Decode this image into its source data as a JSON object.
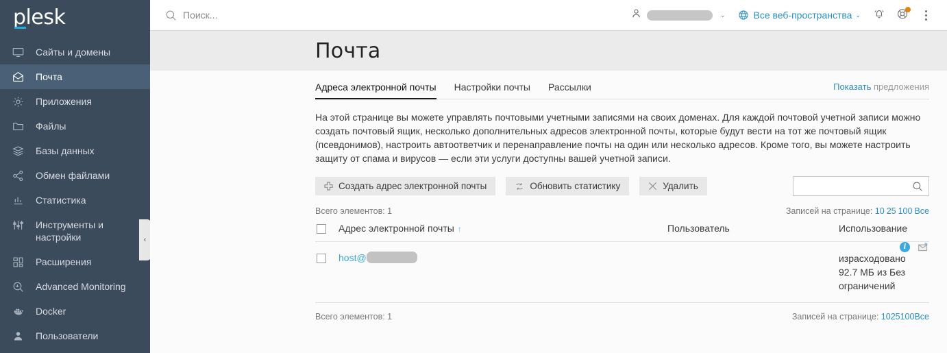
{
  "sidebar": {
    "logo": "plesk",
    "items": [
      {
        "label": "Сайты и домены",
        "icon": "monitor-icon",
        "active": false
      },
      {
        "label": "Почта",
        "icon": "mail-icon",
        "active": true
      },
      {
        "label": "Приложения",
        "icon": "gear-icon",
        "active": false
      },
      {
        "label": "Файлы",
        "icon": "folder-icon",
        "active": false
      },
      {
        "label": "Базы данных",
        "icon": "database-icon",
        "active": false
      },
      {
        "label": "Обмен файлами",
        "icon": "share-icon",
        "active": false
      },
      {
        "label": "Статистика",
        "icon": "chart-icon",
        "active": false
      },
      {
        "label": "Инструменты и настройки",
        "icon": "sliders-icon",
        "active": false
      },
      {
        "label": "Расширения",
        "icon": "extensions-icon",
        "active": false
      },
      {
        "label": "Advanced Monitoring",
        "icon": "magnifier-chart-icon",
        "active": false
      },
      {
        "label": "Docker",
        "icon": "docker-icon",
        "active": false
      },
      {
        "label": "Пользователи",
        "icon": "user-icon",
        "active": false
      }
    ],
    "collapse_label": "‹"
  },
  "topbar": {
    "search_placeholder": "Поиск...",
    "user_name": "",
    "workspace_label": "Все веб-пространства",
    "caret": "⌄"
  },
  "page": {
    "title": "Почта"
  },
  "tabs": [
    {
      "label": "Адреса электронной почты",
      "active": true
    },
    {
      "label": "Настройки почты",
      "active": false
    },
    {
      "label": "Рассылки",
      "active": false
    }
  ],
  "show_offers": {
    "link": "Показать",
    "rest": " предложения"
  },
  "description": "На этой странице вы можете управлять почтовыми учетными записями на своих доменах. Для каждой почтовой учетной записи можно создать почтовый ящик, несколько дополнительных адресов электронной почты, которые будут вести на тот же почтовый ящик (псевдонимов), настроить автоответчик и перенаправление почты на один или несколько адресов. Кроме того, вы можете настроить защиту от спама и вирусов — если эти услуги доступны вашей учетной записи.",
  "toolbar": {
    "create_label": "Создать адрес электронной почты",
    "refresh_label": "Обновить статистику",
    "delete_label": "Удалить",
    "search_value": "",
    "search_placeholder": ""
  },
  "meta": {
    "total_label": "Всего элементов: 1",
    "per_page_label": "Записей на странице:",
    "per_page_options": [
      "10",
      "25",
      "100",
      "Все"
    ]
  },
  "table": {
    "columns": [
      "Адрес электронной почты",
      "Пользователь",
      "Использование"
    ],
    "sort_indicator": "↑",
    "rows": [
      {
        "address_prefix": "host@",
        "address_redacted": true,
        "user": "",
        "usage": "израсходовано 92.7 МБ из Без ограничений"
      }
    ]
  },
  "colors": {
    "sidebar_bg": "#3b4b5c",
    "sidebar_active": "#4a6076",
    "accent_blue": "#2a8fc4",
    "link_blue": "#3ba9e0",
    "logo_underscore": "#28aae1",
    "badge_orange": "#e8810c",
    "title_band": "#ebebeb"
  }
}
